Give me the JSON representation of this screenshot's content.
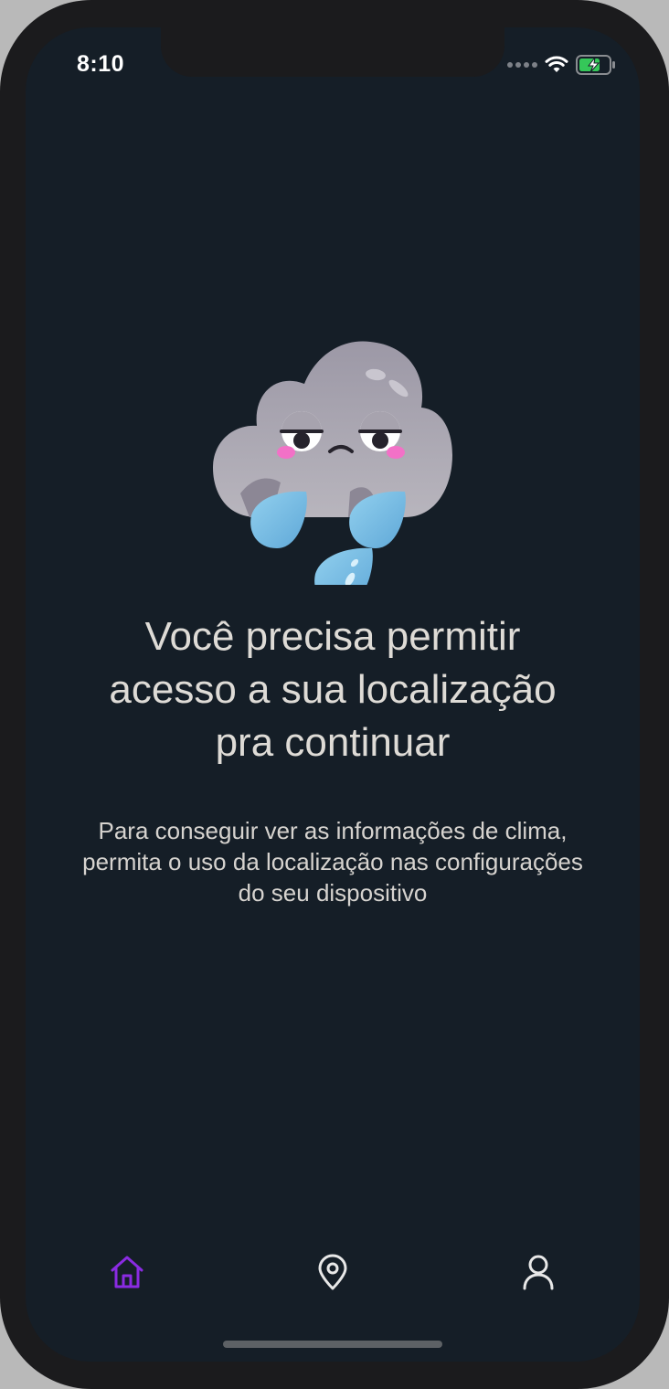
{
  "status_bar": {
    "time": "8:10",
    "icons": [
      "cellular-signal-icon",
      "wifi-icon",
      "battery-charging-icon"
    ]
  },
  "illustration": {
    "icon": "sad-rain-cloud-icon"
  },
  "message": {
    "title_lines": [
      "Você precisa permitir",
      "acesso a sua localização",
      "pra continuar"
    ],
    "subtitle_lines": [
      "Para conseguir ver as informações de clima,",
      "permita o uso da localização nas configurações",
      "do seu dispositivo"
    ]
  },
  "tab_bar": {
    "items": [
      {
        "icon": "home-icon",
        "active": true
      },
      {
        "icon": "location-pin-icon",
        "active": false
      },
      {
        "icon": "user-icon",
        "active": false
      }
    ]
  },
  "colors": {
    "background": "#151e27",
    "text": "#dedbd6",
    "accent": "#8a2be2",
    "inactive_icon": "#e8e8e8"
  }
}
